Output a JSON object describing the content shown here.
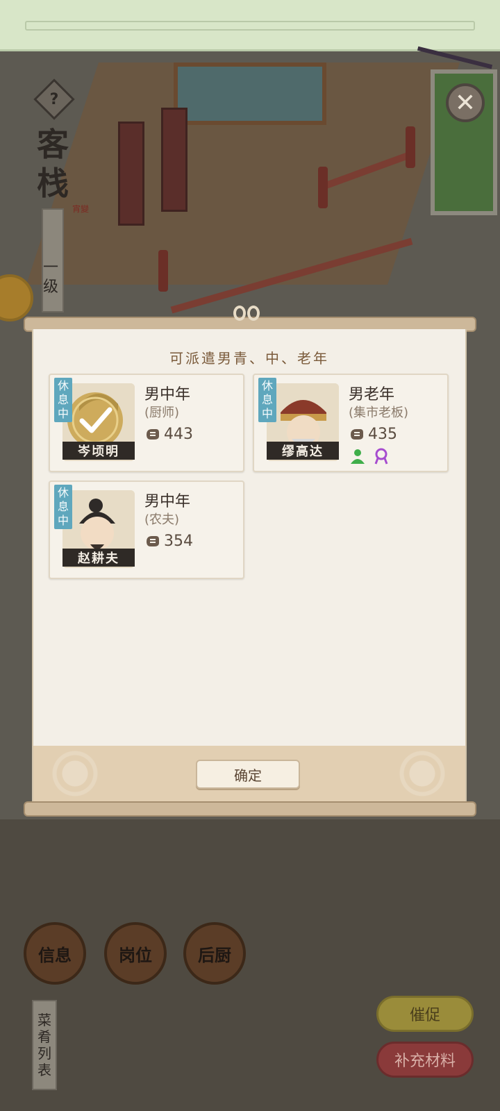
{
  "scene": {
    "inn_title": "客栈",
    "inn_seal": "宵變",
    "level_label": "一级",
    "help_symbol": "?",
    "close_symbol": "✕"
  },
  "dialog": {
    "title": "可派遣男青、中、老年",
    "confirm_label": "确定",
    "characters": [
      {
        "name": "岑顷明",
        "type": "男中年",
        "job": "(厨师)",
        "power": "443",
        "status": "休息中",
        "selected": true,
        "skills": []
      },
      {
        "name": "缪高达",
        "type": "男老年",
        "job": "(集市老板)",
        "power": "435",
        "status": "休息中",
        "selected": false,
        "skills": [
          "green-person-icon",
          "purple-person-icon"
        ]
      },
      {
        "name": "赵耕夫",
        "type": "男中年",
        "job": "(农夫)",
        "power": "354",
        "status": "休息中",
        "selected": false,
        "skills": []
      }
    ]
  },
  "bottom": {
    "info_label": "信息",
    "post_label": "岗位",
    "kitchen_label": "后厨",
    "menu_label": "菜肴列表",
    "urge_label": "催促",
    "supply_label": "补充材料"
  },
  "colors": {
    "rest_tag": "#5fa7bd",
    "accent_brown": "#7a5a3a",
    "overlay_dim": "#5d5a52"
  }
}
